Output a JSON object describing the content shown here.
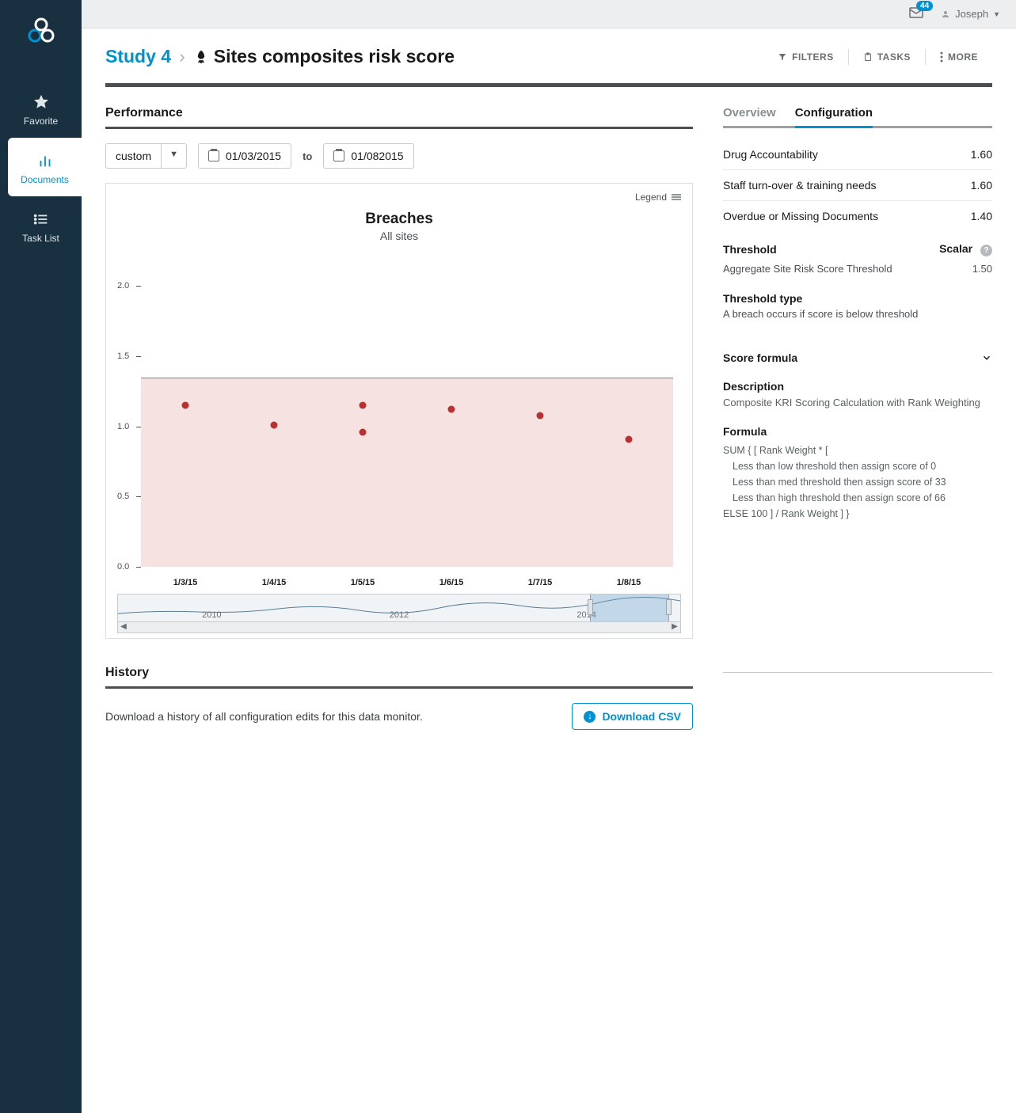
{
  "topbar": {
    "badge": "44",
    "user": "Joseph"
  },
  "sidebar": {
    "items": [
      {
        "label": "Favorite"
      },
      {
        "label": "Documents"
      },
      {
        "label": "Task List"
      }
    ]
  },
  "breadcrumb": {
    "study": "Study 4",
    "title": "Sites composites risk score"
  },
  "actions": {
    "filters": "FILTERS",
    "tasks": "TASKS",
    "more": "MORE"
  },
  "performance": {
    "section_title": "Performance",
    "range_mode": "custom",
    "date_from": "01/03/2015",
    "to_label": "to",
    "date_to": "01/082015",
    "legend_label": "Legend",
    "chart_title": "Breaches",
    "chart_subtitle": "All sites",
    "brush_years": [
      "2010",
      "2012",
      "2014"
    ]
  },
  "chart_data": {
    "type": "scatter",
    "x_categories": [
      "1/3/15",
      "1/4/15",
      "1/5/15",
      "1/5/15",
      "1/6/15",
      "1/7/15",
      "1/8/15"
    ],
    "x_axis_ticks": [
      "1/3/15",
      "1/4/15",
      "1/5/15",
      "1/6/15",
      "1/7/15",
      "1/8/15"
    ],
    "values": [
      1.15,
      1.01,
      1.15,
      0.96,
      1.12,
      1.08,
      0.91
    ],
    "ylim": [
      0.0,
      2.2
    ],
    "y_ticks": [
      0.0,
      0.5,
      1.0,
      1.5,
      2.0
    ],
    "threshold": 1.35,
    "threshold_direction": "below",
    "title": "Breaches",
    "subtitle": "All sites",
    "xlabel": "",
    "ylabel": ""
  },
  "tabs": {
    "overview": "Overview",
    "configuration": "Configuration",
    "active": "configuration"
  },
  "config_rows": [
    {
      "label": "Drug Accountability",
      "value": "1.60"
    },
    {
      "label": "Staff turn-over & training needs",
      "value": "1.60"
    },
    {
      "label": "Overdue or Missing Documents",
      "value": "1.40"
    }
  ],
  "threshold": {
    "head_label": "Threshold",
    "scalar_label": "Scalar",
    "name": "Aggregate Site Risk Score Threshold",
    "value": "1.50",
    "type_label": "Threshold type",
    "type_value": "A breach occurs if score is below threshold"
  },
  "score_formula": {
    "head": "Score formula",
    "description_label": "Description",
    "description_value": "Composite KRI Scoring Calculation with Rank Weighting",
    "formula_label": "Formula",
    "lines": [
      "SUM { [ Rank Weight * [",
      "Less than low threshold then assign score of 0",
      "Less than med threshold then assign score of 33",
      "Less than high threshold then assign score of 66",
      "ELSE 100 ] / Rank Weight ] }"
    ]
  },
  "history": {
    "title": "History",
    "text": "Download a history of all configuration edits for this data monitor.",
    "button": "Download CSV"
  }
}
